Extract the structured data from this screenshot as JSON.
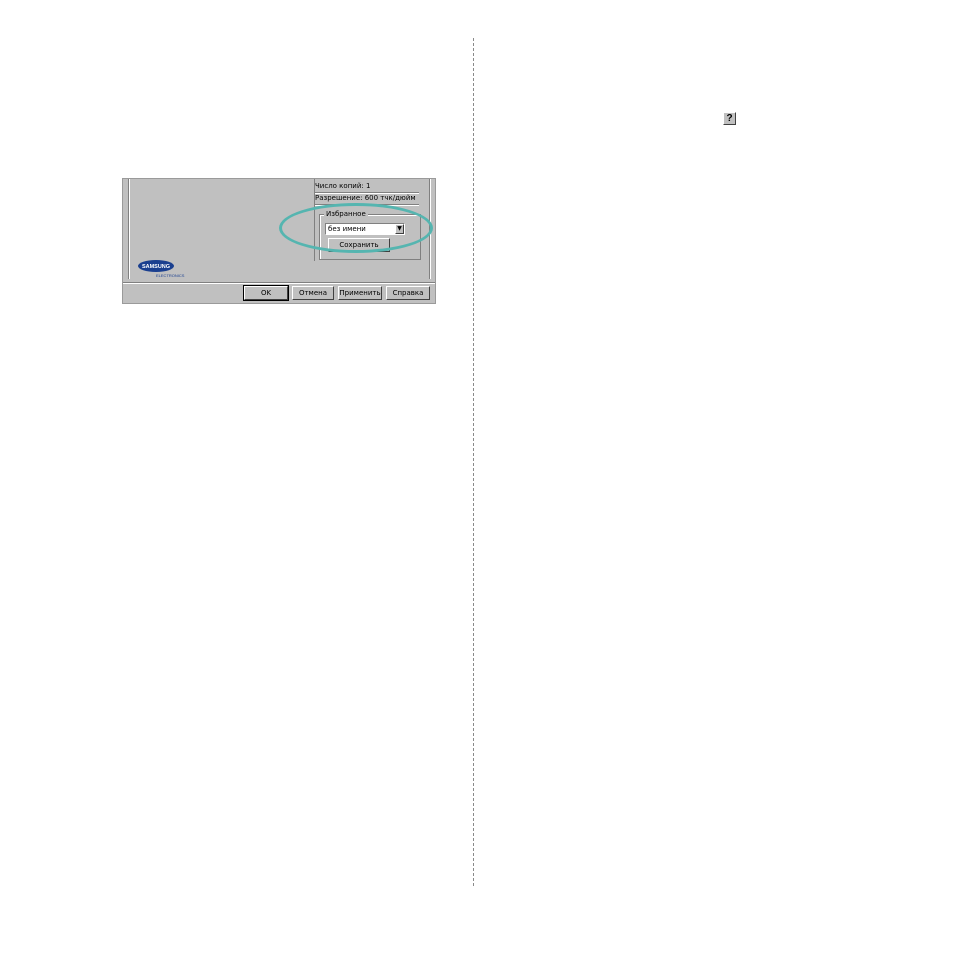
{
  "help_button": {
    "label": "?"
  },
  "dialog": {
    "summary": {
      "copies": "Число копий: 1",
      "resolution": "Разрешение: 600 тчк/дюйм"
    },
    "favorites": {
      "legend": "Избранное",
      "selected": "без имени",
      "save_label": "Сохранить"
    },
    "logo": {
      "brand": "SAMSUNG",
      "sub": "ELECTRONICS"
    },
    "buttons": {
      "ok": "OK",
      "cancel": "Отмена",
      "apply": "Применить",
      "help": "Справка"
    }
  },
  "colors": {
    "highlight": "#55b5b0",
    "dialog_bg": "#c0c0c0",
    "logo_blue": "#1a3f8f"
  }
}
